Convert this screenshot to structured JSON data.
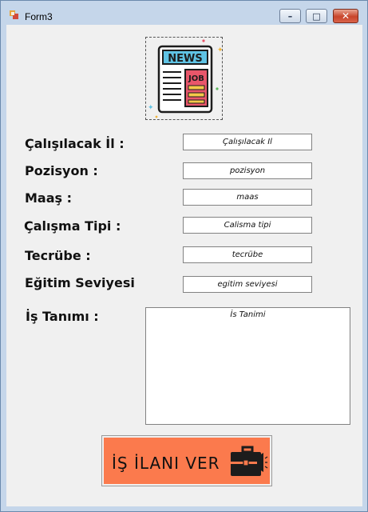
{
  "window": {
    "title": "Form3"
  },
  "controls": {
    "minimize": "–",
    "maximize": "□",
    "close": "✕"
  },
  "logo": {
    "banner": "NEWS",
    "tag": "JOB",
    "icon": "newspaper-icon"
  },
  "form": {
    "city": {
      "label": "Çalışılacak İl :",
      "value": "Çalışılacak İl"
    },
    "position": {
      "label": "Pozisyon :",
      "value": "pozisyon"
    },
    "salary": {
      "label": "Maaş :",
      "value": "maas"
    },
    "work_type": {
      "label": "Çalışma Tipi :",
      "value": "Calisma tipi"
    },
    "experience": {
      "label": "Tecrübe :",
      "value": "tecrübe"
    },
    "education": {
      "label": "Eğitim Seviyesi",
      "value": "egitim seviyesi"
    },
    "job_desc": {
      "label": "İş Tanımı :",
      "value": "İs Tanimi"
    }
  },
  "submit": {
    "label": "İŞ İLANI VER",
    "icon": "briefcase-megaphone-icon"
  },
  "colors": {
    "button_bg": "#fb7a4d",
    "frame": "#c5d6ea"
  }
}
